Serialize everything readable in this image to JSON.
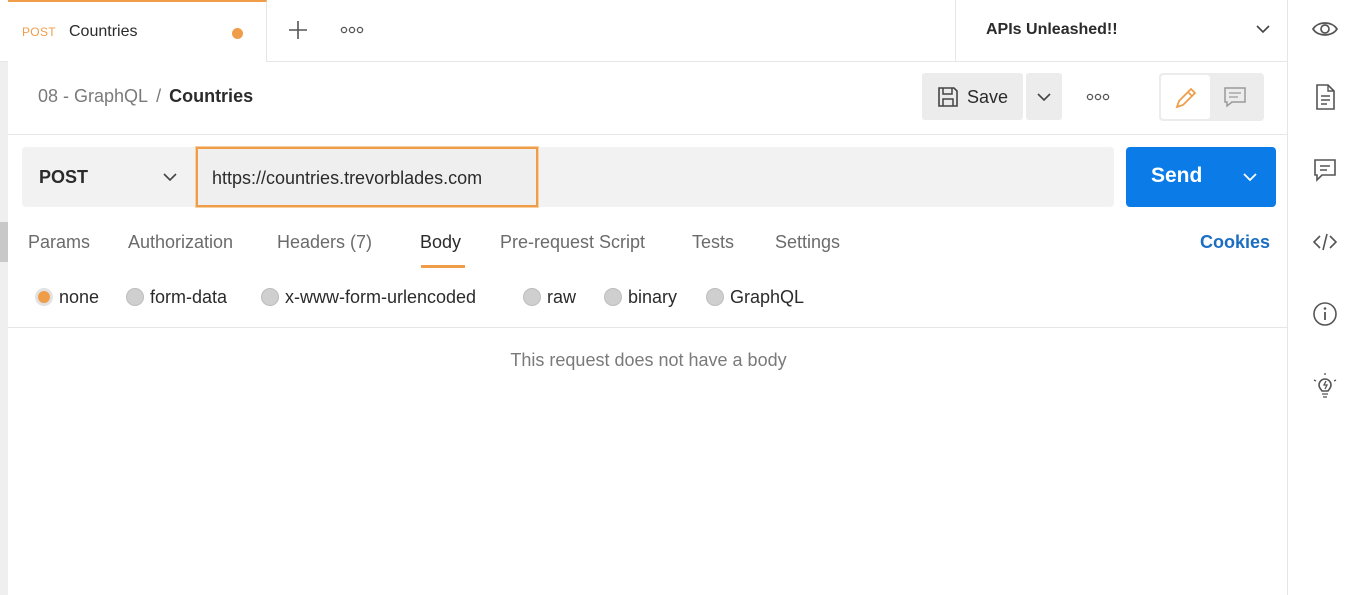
{
  "tab": {
    "method": "POST",
    "name": "Countries"
  },
  "environment": {
    "name": "APIs Unleashed!!"
  },
  "breadcrumb": {
    "parent": "08 - GraphQL",
    "separator": "/",
    "current": "Countries"
  },
  "toolbar": {
    "save_label": "Save"
  },
  "request": {
    "method": "POST",
    "url": "https://countries.trevorblades.com",
    "send_label": "Send"
  },
  "subtabs": [
    "Params",
    "Authorization",
    "Headers (7)",
    "Body",
    "Pre-request Script",
    "Tests",
    "Settings"
  ],
  "active_subtab": "Body",
  "cookies_label": "Cookies",
  "body_modes": [
    "none",
    "form-data",
    "x-www-form-urlencoded",
    "raw",
    "binary",
    "GraphQL"
  ],
  "selected_body_mode": "none",
  "empty_body_message": "This request does not have a body",
  "colors": {
    "accent": "#f09d4a",
    "send": "#0b7be8",
    "link": "#1b6ec2"
  }
}
